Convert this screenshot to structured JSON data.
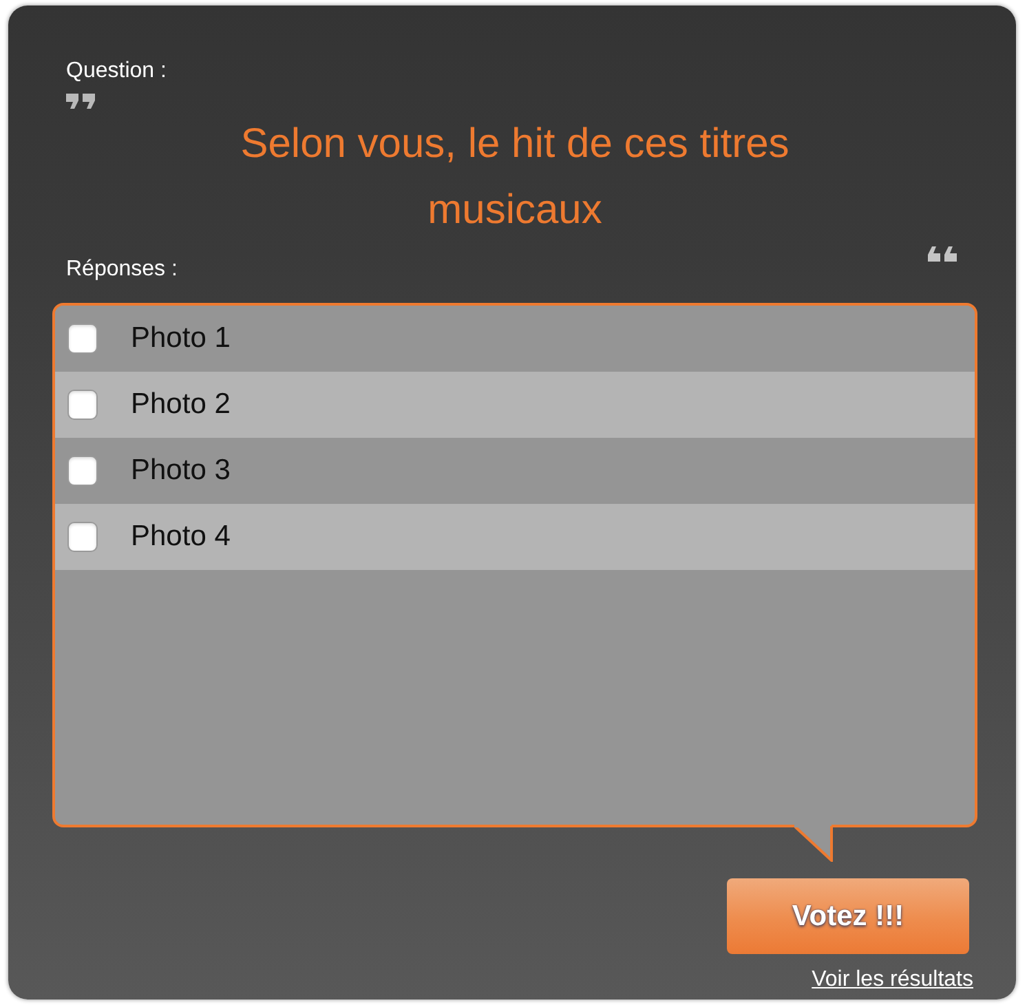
{
  "question": {
    "label": "Question :",
    "text": "Selon vous, le hit de ces titres musicaux"
  },
  "answers": {
    "label": "Réponses :",
    "options": [
      {
        "label": "Photo 1",
        "checked": false
      },
      {
        "label": "Photo 2",
        "checked": false
      },
      {
        "label": "Photo 3",
        "checked": false
      },
      {
        "label": "Photo 4",
        "checked": false
      }
    ]
  },
  "vote_button": "Votez !!!",
  "results_link": "Voir les résultats"
}
